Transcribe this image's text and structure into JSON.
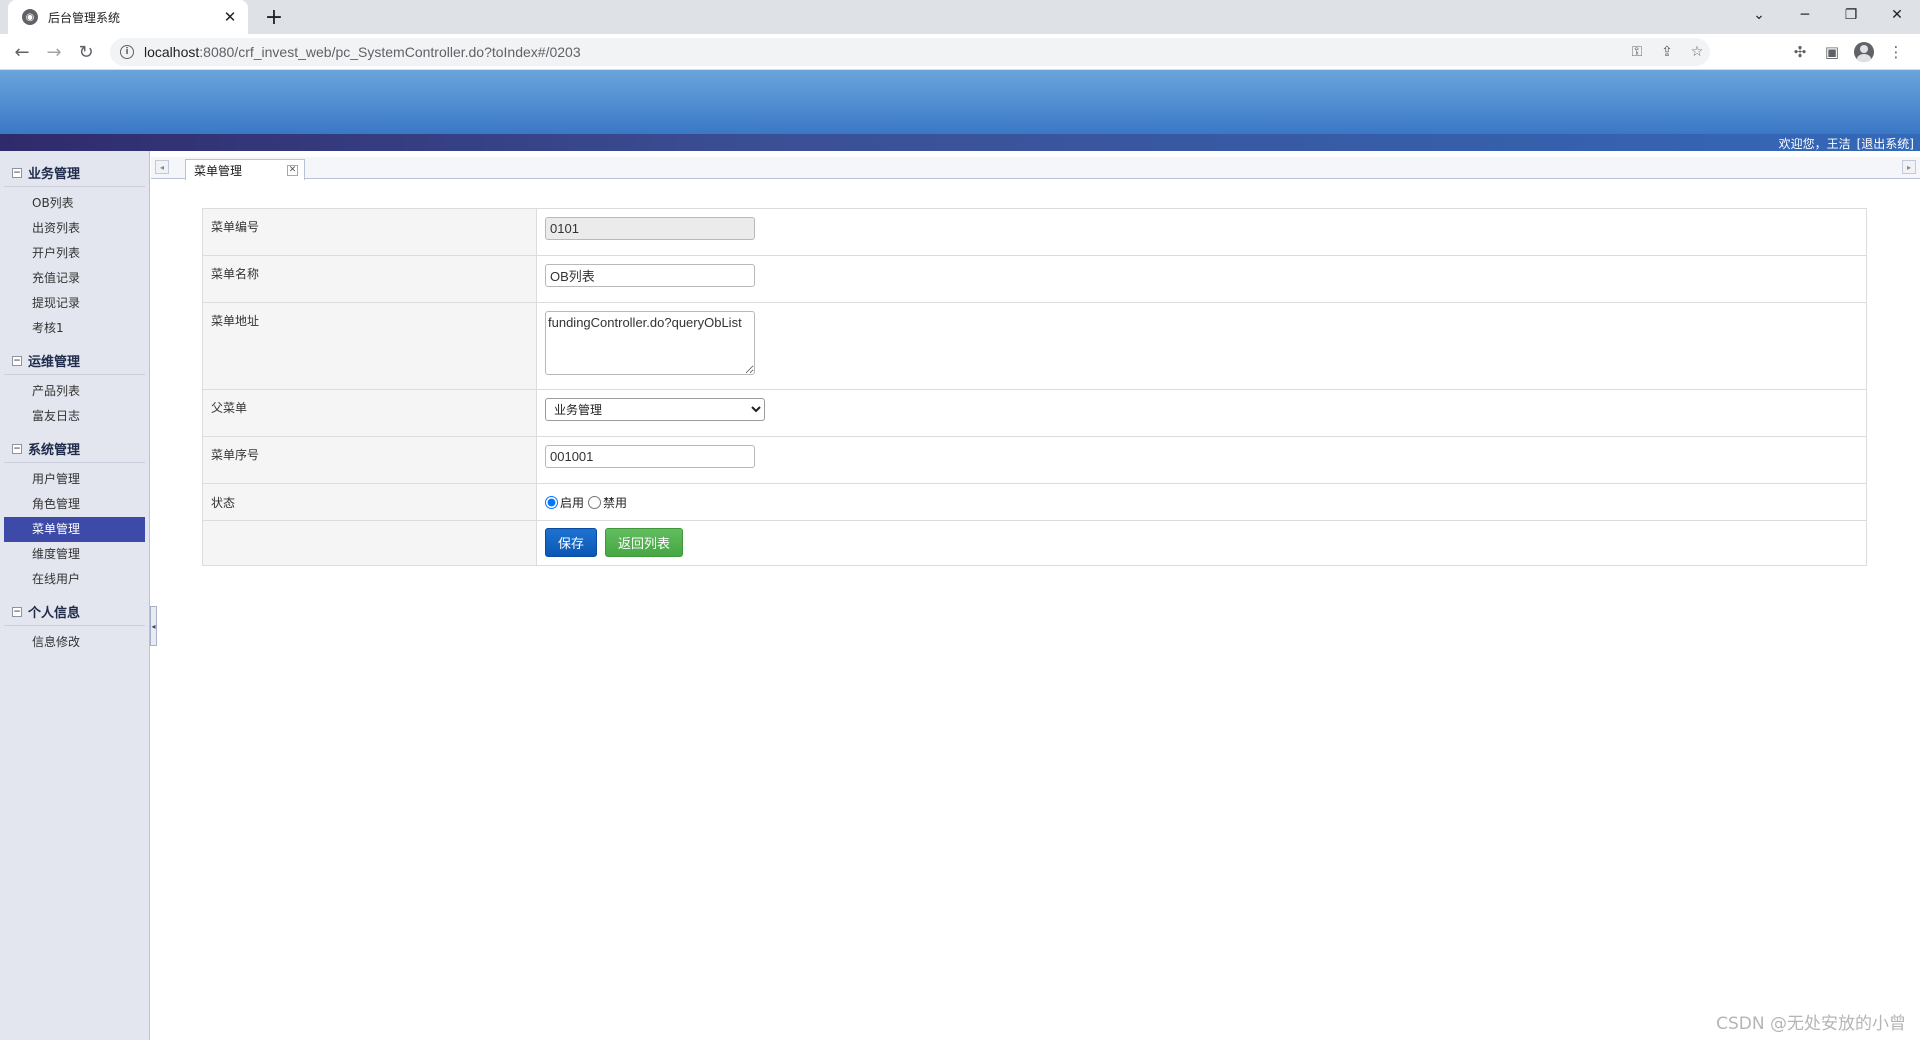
{
  "browser": {
    "tab_title": "后台管理系统",
    "url_host": "localhost",
    "url_rest": ":8080/crf_invest_web/pc_SystemController.do?toIndex#/0203"
  },
  "header": {
    "welcome_text": "欢迎您，王洁",
    "logout_label": "[退出系统]"
  },
  "sidebar": {
    "groups": [
      {
        "title": "业务管理",
        "items": [
          "OB列表",
          "出资列表",
          "开户列表",
          "充值记录",
          "提现记录",
          "考核1"
        ]
      },
      {
        "title": "运维管理",
        "items": [
          "产品列表",
          "富友日志"
        ]
      },
      {
        "title": "系统管理",
        "items": [
          "用户管理",
          "角色管理",
          "菜单管理",
          "维度管理",
          "在线用户"
        ]
      },
      {
        "title": "个人信息",
        "items": [
          "信息修改"
        ]
      }
    ],
    "active_item": "菜单管理"
  },
  "tabs": {
    "active_tab": "菜单管理"
  },
  "form": {
    "menu_code_label": "菜单编号",
    "menu_code_value": "0101",
    "menu_name_label": "菜单名称",
    "menu_name_value": "OB列表",
    "menu_url_label": "菜单地址",
    "menu_url_value": "fundingController.do?queryObList",
    "parent_menu_label": "父菜单",
    "parent_menu_value": "业务管理",
    "menu_order_label": "菜单序号",
    "menu_order_value": "001001",
    "status_label": "状态",
    "status_enabled_label": "启用",
    "status_disabled_label": "禁用",
    "status_selected": "enabled",
    "save_label": "保存",
    "back_label": "返回列表"
  },
  "watermark": "CSDN @无处安放的小曾",
  "colors": {
    "banner_top": "#6aa4dc",
    "banner_bottom": "#3a78c6",
    "active_menu": "#3d4aa8",
    "save_button": "#0b57b5",
    "back_button": "#47a744"
  }
}
